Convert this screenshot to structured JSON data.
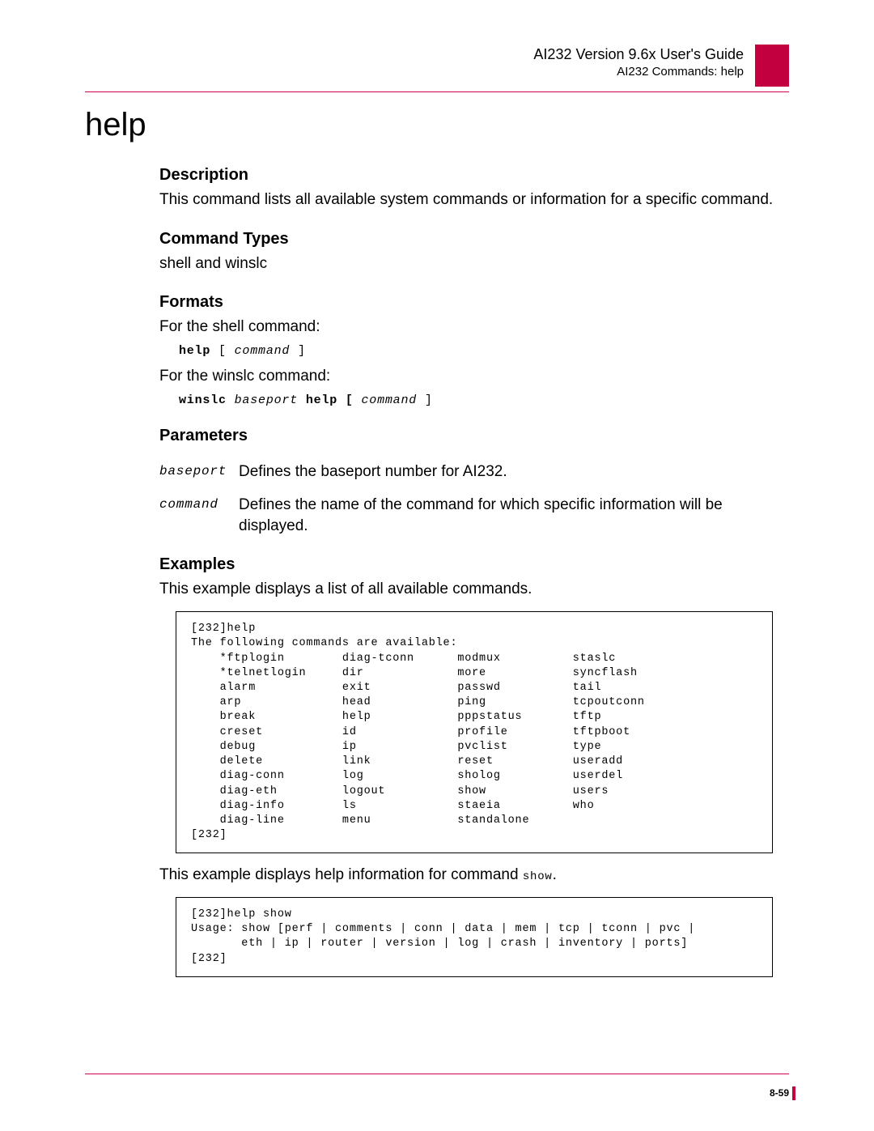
{
  "header": {
    "title": "AI232 Version 9.6x User's Guide",
    "sub": "AI232 Commands: help"
  },
  "page_title": "help",
  "sections": {
    "description": {
      "heading": "Description",
      "body": "This command lists all available system commands or information for a specific command."
    },
    "command_types": {
      "heading": "Command Types",
      "body": "shell and winslc"
    },
    "formats": {
      "heading": "Formats",
      "intro1": "For the shell command:",
      "line1_cmd": "help",
      "line1_open": " [ ",
      "line1_arg": "command",
      "line1_close": " ]",
      "intro2": "For the winslc command:",
      "line2_cmd": "winslc ",
      "line2_arg1": "baseport",
      "line2_mid": " help [ ",
      "line2_arg2": "command",
      "line2_close": " ]"
    },
    "parameters": {
      "heading": "Parameters",
      "rows": [
        {
          "name": "baseport",
          "def": "Defines the baseport number for AI232."
        },
        {
          "name": "command",
          "def": "Defines the name of the command for which specific information will be displayed."
        }
      ]
    },
    "examples": {
      "heading": "Examples",
      "intro1": "This example displays a list of all available commands.",
      "box1": "[232]help\nThe following commands are available:\n    *ftplogin        diag-tconn      modmux          staslc\n    *telnetlogin     dir             more            syncflash\n    alarm            exit            passwd          tail\n    arp              head            ping            tcpoutconn\n    break            help            pppstatus       tftp\n    creset           id              profile         tftpboot\n    debug            ip              pvclist         type\n    delete           link            reset           useradd\n    diag-conn        log             sholog          userdel\n    diag-eth         logout          show            users\n    diag-info        ls              staeia          who\n    diag-line        menu            standalone\n[232]",
      "intro2_pre": "This example displays help information for command ",
      "intro2_cmd": "show",
      "intro2_post": ".",
      "box2": "[232]help show\nUsage: show [perf | comments | conn | data | mem | tcp | tconn | pvc |\n       eth | ip | router | version | log | crash | inventory | ports]\n[232]"
    }
  },
  "footer": {
    "page_num": "8-59"
  }
}
